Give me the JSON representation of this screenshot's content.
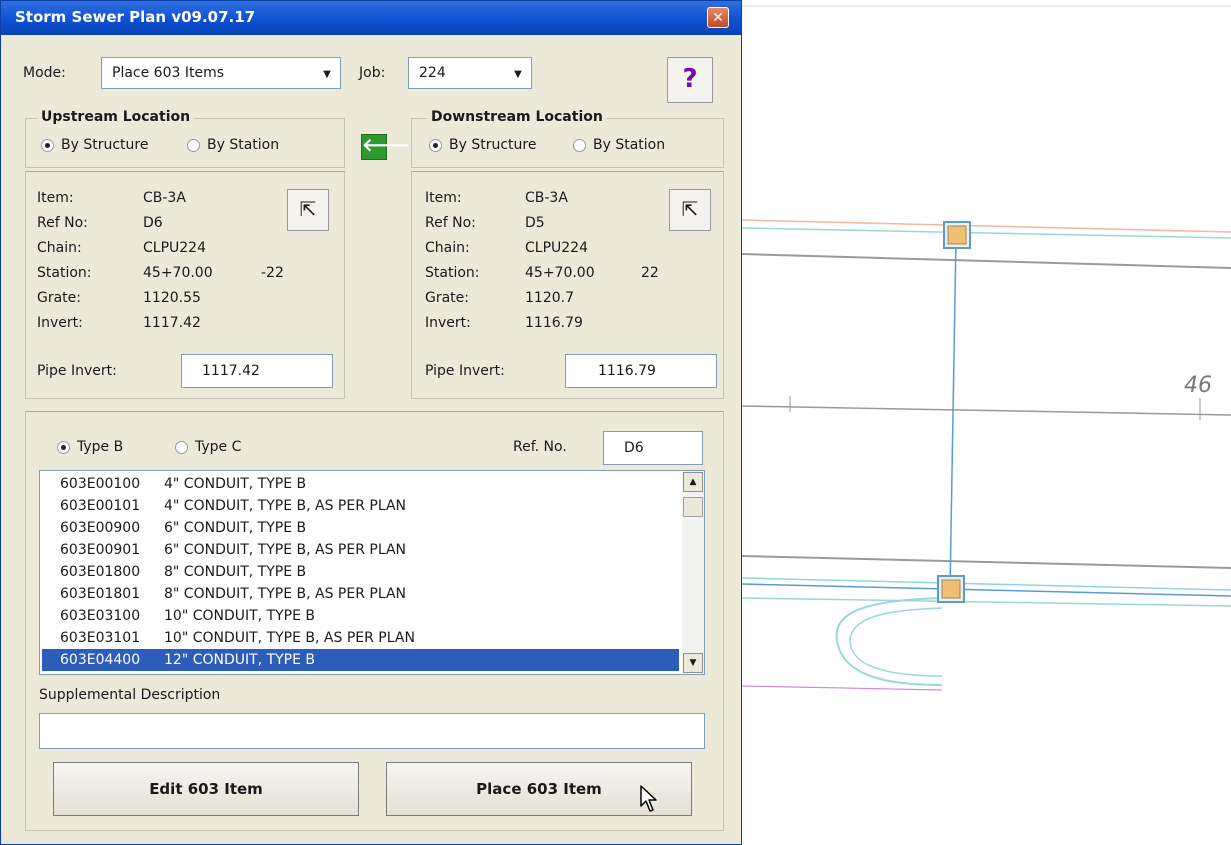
{
  "window": {
    "title": "Storm Sewer Plan v09.07.17",
    "close_glyph": "✕"
  },
  "toolbar": {
    "mode_label": "Mode:",
    "mode_value": "Place 603 Items",
    "job_label": "Job:",
    "job_value": "224",
    "help_glyph": "?"
  },
  "upstream": {
    "group_title": "Upstream Location",
    "by_structure": "By Structure",
    "by_station": "By Station",
    "selected_mode": "By Structure",
    "fields": {
      "item_label": "Item:",
      "item": "CB-3A",
      "refno_label": "Ref No:",
      "refno": "D6",
      "chain_label": "Chain:",
      "chain": "CLPU224",
      "station_label": "Station:",
      "station": "45+70.00",
      "offset": "-22",
      "grate_label": "Grate:",
      "grate": "1120.55",
      "invert_label": "Invert:",
      "invert": "1117.42"
    },
    "pipe_invert_label": "Pipe Invert:",
    "pipe_invert_value": "1117.42"
  },
  "downstream": {
    "group_title": "Downstream Location",
    "by_structure": "By Structure",
    "by_station": "By Station",
    "selected_mode": "By Structure",
    "fields": {
      "item_label": "Item:",
      "item": "CB-3A",
      "refno_label": "Ref No:",
      "refno": "D5",
      "chain_label": "Chain:",
      "chain": "CLPU224",
      "station_label": "Station:",
      "station": "45+70.00",
      "offset": "22",
      "grate_label": "Grate:",
      "grate": "1120.7",
      "invert_label": "Invert:",
      "invert": "1116.79"
    },
    "pipe_invert_label": "Pipe Invert:",
    "pipe_invert_value": "1116.79"
  },
  "copy_arrow_glyph": "🡐",
  "items_panel": {
    "type_b_label": "Type B",
    "type_c_label": "Type C",
    "selected_type": "Type B",
    "refno_label": "Ref. No.",
    "refno_value": "D6",
    "items": [
      {
        "code": "603E00100",
        "desc": "4\" CONDUIT, TYPE B"
      },
      {
        "code": "603E00101",
        "desc": "4\" CONDUIT, TYPE B, AS PER PLAN"
      },
      {
        "code": "603E00900",
        "desc": "6\" CONDUIT, TYPE B"
      },
      {
        "code": "603E00901",
        "desc": "6\" CONDUIT, TYPE B, AS PER PLAN"
      },
      {
        "code": "603E01800",
        "desc": "8\" CONDUIT, TYPE B"
      },
      {
        "code": "603E01801",
        "desc": "8\" CONDUIT, TYPE B, AS PER PLAN"
      },
      {
        "code": "603E03100",
        "desc": "10\" CONDUIT, TYPE B"
      },
      {
        "code": "603E03101",
        "desc": "10\" CONDUIT, TYPE B, AS PER PLAN"
      },
      {
        "code": "603E04400",
        "desc": "12\" CONDUIT, TYPE B"
      }
    ],
    "selected_index": 8,
    "supplemental_label": "Supplemental Description",
    "supplemental_value": "",
    "edit_button": "Edit 603 Item",
    "place_button": "Place 603 Item"
  },
  "cad": {
    "station_label": "46"
  },
  "colors": {
    "title_bar": "#0d4fcf",
    "dialog_bg": "#ece9d8",
    "selection": "#2c5dba",
    "help_icon": "#7b0aa6",
    "cad_line": "#5b9bd5"
  }
}
